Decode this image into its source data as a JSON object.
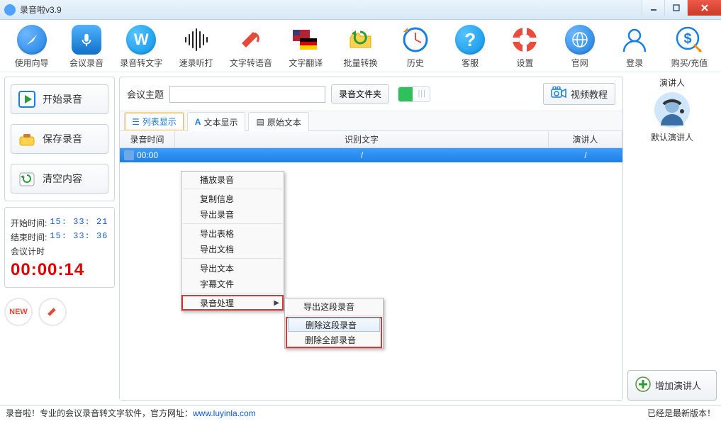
{
  "window": {
    "title": "录音啦v3.9"
  },
  "toolbar": {
    "items": [
      {
        "name": "guide",
        "label": "使用向导",
        "icon": "compass"
      },
      {
        "name": "record-meeting",
        "label": "会议录音",
        "icon": "mic"
      },
      {
        "name": "audio-to-text",
        "label": "录音转文字",
        "icon": "w"
      },
      {
        "name": "fast-listen",
        "label": "速录听打",
        "icon": "sound"
      },
      {
        "name": "text-to-speech",
        "label": "文字转语音",
        "icon": "mega"
      },
      {
        "name": "translate",
        "label": "文字翻译",
        "icon": "flags"
      },
      {
        "name": "batch",
        "label": "批量转换",
        "icon": "folder"
      },
      {
        "name": "history",
        "label": "历史",
        "icon": "clock"
      },
      {
        "name": "support",
        "label": "客服",
        "icon": "help"
      },
      {
        "name": "settings",
        "label": "设置",
        "icon": "buoy"
      },
      {
        "name": "website",
        "label": "官网",
        "icon": "globe"
      },
      {
        "name": "login",
        "label": "登录",
        "icon": "user"
      },
      {
        "name": "buy",
        "label": "购买/充值",
        "icon": "dollar"
      }
    ]
  },
  "side": {
    "start": "开始录音",
    "save": "保存录音",
    "clear": "清空内容",
    "start_time_label": "开始时间:",
    "start_time_val": "15: 33: 21",
    "end_time_label": "结束时间:",
    "end_time_val": "15: 33: 36",
    "timer_label": "会议计时",
    "timer_val": "00:00:14"
  },
  "mid": {
    "subject_label": "会议主题",
    "subject_value": "",
    "folder_btn": "录音文件夹",
    "video_btn": "视频教程",
    "tabs": {
      "list": "列表显示",
      "text": "文本显示",
      "raw": "原始文本"
    },
    "cols": {
      "time": "录音时间",
      "text": "识别文字",
      "speaker": "演讲人"
    },
    "rows": [
      {
        "time": "00:00",
        "text": "/",
        "speaker": "/"
      }
    ]
  },
  "ctx": {
    "play": "播放录音",
    "copy": "复制信息",
    "export_audio": "导出录音",
    "export_table": "导出表格",
    "export_doc": "导出文档",
    "export_text": "导出文本",
    "subtitle": "字幕文件",
    "process": "录音处理",
    "sub": {
      "export_seg": "导出这段录音",
      "del_seg": "删除这段录音",
      "del_all": "删除全部录音"
    }
  },
  "right": {
    "title": "演讲人",
    "default_name": "默认演讲人",
    "add": "增加演讲人"
  },
  "status": {
    "left_prefix": "录音啦！专业的会议录音转文字软件，官方网址：",
    "url": "www.luyinla.com",
    "right": "已经是最新版本！"
  }
}
